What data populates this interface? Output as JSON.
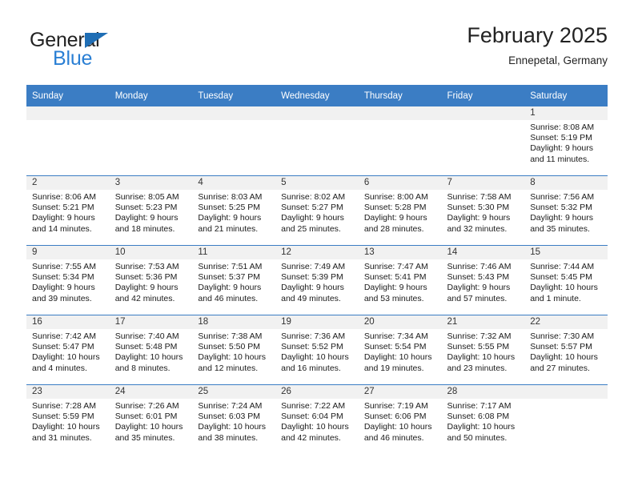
{
  "brand": {
    "name_part1": "General",
    "name_part2": "Blue",
    "triangle_color": "#1f6eb5",
    "blue_color": "#2a7fd4"
  },
  "header": {
    "title": "February 2025",
    "subtitle": "Ennepetal, Germany"
  },
  "theme": {
    "header_row_bg": "#3b7dc4",
    "day_band_bg": "#f1f1f1",
    "grid_line": "#3b7dc4"
  },
  "weekdays": [
    "Sunday",
    "Monday",
    "Tuesday",
    "Wednesday",
    "Thursday",
    "Friday",
    "Saturday"
  ],
  "weeks": [
    [
      {
        "day": "",
        "blank": true
      },
      {
        "day": "",
        "blank": true
      },
      {
        "day": "",
        "blank": true
      },
      {
        "day": "",
        "blank": true
      },
      {
        "day": "",
        "blank": true
      },
      {
        "day": "",
        "blank": true
      },
      {
        "day": "1",
        "sunrise": "Sunrise: 8:08 AM",
        "sunset": "Sunset: 5:19 PM",
        "daylight": "Daylight: 9 hours and 11 minutes."
      }
    ],
    [
      {
        "day": "2",
        "sunrise": "Sunrise: 8:06 AM",
        "sunset": "Sunset: 5:21 PM",
        "daylight": "Daylight: 9 hours and 14 minutes."
      },
      {
        "day": "3",
        "sunrise": "Sunrise: 8:05 AM",
        "sunset": "Sunset: 5:23 PM",
        "daylight": "Daylight: 9 hours and 18 minutes."
      },
      {
        "day": "4",
        "sunrise": "Sunrise: 8:03 AM",
        "sunset": "Sunset: 5:25 PM",
        "daylight": "Daylight: 9 hours and 21 minutes."
      },
      {
        "day": "5",
        "sunrise": "Sunrise: 8:02 AM",
        "sunset": "Sunset: 5:27 PM",
        "daylight": "Daylight: 9 hours and 25 minutes."
      },
      {
        "day": "6",
        "sunrise": "Sunrise: 8:00 AM",
        "sunset": "Sunset: 5:28 PM",
        "daylight": "Daylight: 9 hours and 28 minutes."
      },
      {
        "day": "7",
        "sunrise": "Sunrise: 7:58 AM",
        "sunset": "Sunset: 5:30 PM",
        "daylight": "Daylight: 9 hours and 32 minutes."
      },
      {
        "day": "8",
        "sunrise": "Sunrise: 7:56 AM",
        "sunset": "Sunset: 5:32 PM",
        "daylight": "Daylight: 9 hours and 35 minutes."
      }
    ],
    [
      {
        "day": "9",
        "sunrise": "Sunrise: 7:55 AM",
        "sunset": "Sunset: 5:34 PM",
        "daylight": "Daylight: 9 hours and 39 minutes."
      },
      {
        "day": "10",
        "sunrise": "Sunrise: 7:53 AM",
        "sunset": "Sunset: 5:36 PM",
        "daylight": "Daylight: 9 hours and 42 minutes."
      },
      {
        "day": "11",
        "sunrise": "Sunrise: 7:51 AM",
        "sunset": "Sunset: 5:37 PM",
        "daylight": "Daylight: 9 hours and 46 minutes."
      },
      {
        "day": "12",
        "sunrise": "Sunrise: 7:49 AM",
        "sunset": "Sunset: 5:39 PM",
        "daylight": "Daylight: 9 hours and 49 minutes."
      },
      {
        "day": "13",
        "sunrise": "Sunrise: 7:47 AM",
        "sunset": "Sunset: 5:41 PM",
        "daylight": "Daylight: 9 hours and 53 minutes."
      },
      {
        "day": "14",
        "sunrise": "Sunrise: 7:46 AM",
        "sunset": "Sunset: 5:43 PM",
        "daylight": "Daylight: 9 hours and 57 minutes."
      },
      {
        "day": "15",
        "sunrise": "Sunrise: 7:44 AM",
        "sunset": "Sunset: 5:45 PM",
        "daylight": "Daylight: 10 hours and 1 minute."
      }
    ],
    [
      {
        "day": "16",
        "sunrise": "Sunrise: 7:42 AM",
        "sunset": "Sunset: 5:47 PM",
        "daylight": "Daylight: 10 hours and 4 minutes."
      },
      {
        "day": "17",
        "sunrise": "Sunrise: 7:40 AM",
        "sunset": "Sunset: 5:48 PM",
        "daylight": "Daylight: 10 hours and 8 minutes."
      },
      {
        "day": "18",
        "sunrise": "Sunrise: 7:38 AM",
        "sunset": "Sunset: 5:50 PM",
        "daylight": "Daylight: 10 hours and 12 minutes."
      },
      {
        "day": "19",
        "sunrise": "Sunrise: 7:36 AM",
        "sunset": "Sunset: 5:52 PM",
        "daylight": "Daylight: 10 hours and 16 minutes."
      },
      {
        "day": "20",
        "sunrise": "Sunrise: 7:34 AM",
        "sunset": "Sunset: 5:54 PM",
        "daylight": "Daylight: 10 hours and 19 minutes."
      },
      {
        "day": "21",
        "sunrise": "Sunrise: 7:32 AM",
        "sunset": "Sunset: 5:55 PM",
        "daylight": "Daylight: 10 hours and 23 minutes."
      },
      {
        "day": "22",
        "sunrise": "Sunrise: 7:30 AM",
        "sunset": "Sunset: 5:57 PM",
        "daylight": "Daylight: 10 hours and 27 minutes."
      }
    ],
    [
      {
        "day": "23",
        "sunrise": "Sunrise: 7:28 AM",
        "sunset": "Sunset: 5:59 PM",
        "daylight": "Daylight: 10 hours and 31 minutes."
      },
      {
        "day": "24",
        "sunrise": "Sunrise: 7:26 AM",
        "sunset": "Sunset: 6:01 PM",
        "daylight": "Daylight: 10 hours and 35 minutes."
      },
      {
        "day": "25",
        "sunrise": "Sunrise: 7:24 AM",
        "sunset": "Sunset: 6:03 PM",
        "daylight": "Daylight: 10 hours and 38 minutes."
      },
      {
        "day": "26",
        "sunrise": "Sunrise: 7:22 AM",
        "sunset": "Sunset: 6:04 PM",
        "daylight": "Daylight: 10 hours and 42 minutes."
      },
      {
        "day": "27",
        "sunrise": "Sunrise: 7:19 AM",
        "sunset": "Sunset: 6:06 PM",
        "daylight": "Daylight: 10 hours and 46 minutes."
      },
      {
        "day": "28",
        "sunrise": "Sunrise: 7:17 AM",
        "sunset": "Sunset: 6:08 PM",
        "daylight": "Daylight: 10 hours and 50 minutes."
      },
      {
        "day": "",
        "blank": true
      }
    ]
  ]
}
